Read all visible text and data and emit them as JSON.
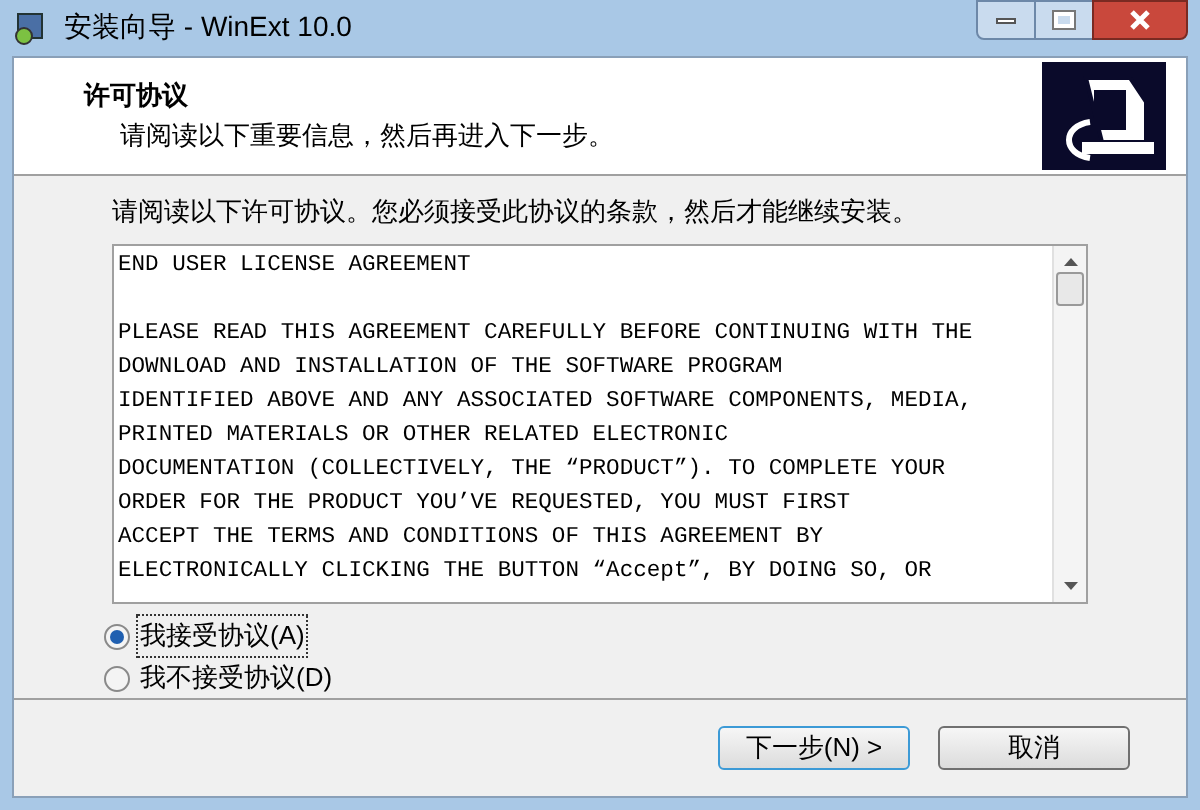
{
  "window": {
    "title": "安装向导 - WinExt 10.0"
  },
  "header": {
    "title": "许可协议",
    "subtitle": "请阅读以下重要信息，然后再进入下一步。"
  },
  "instruction": "请阅读以下许可协议。您必须接受此协议的条款，然后才能继续安装。",
  "license_paragraphs": [
    [
      "END USER LICENSE AGREEMENT"
    ],
    [
      "PLEASE READ THIS AGREEMENT CAREFULLY BEFORE CONTINUING WITH THE",
      "DOWNLOAD AND INSTALLATION OF THE SOFTWARE PROGRAM",
      "IDENTIFIED ABOVE AND ANY ASSOCIATED SOFTWARE COMPONENTS, MEDIA,",
      "PRINTED MATERIALS OR OTHER RELATED ELECTRONIC",
      "DOCUMENTATION (COLLECTIVELY, THE “PRODUCT”). TO COMPLETE YOUR",
      "ORDER FOR THE PRODUCT YOU’VE REQUESTED, YOU MUST FIRST",
      "ACCEPT THE TERMS AND CONDITIONS OF THIS AGREEMENT BY",
      "ELECTRONICALLY CLICKING THE BUTTON “Accept”, BY DOING SO, OR"
    ]
  ],
  "options": [
    {
      "label": "我接受协议(A)",
      "selected": true
    },
    {
      "label": "我不接受协议(D)",
      "selected": false
    }
  ],
  "buttons": [
    {
      "label": "下一步(N) >",
      "kind": "default"
    },
    {
      "label": "取消",
      "kind": "normal"
    }
  ]
}
